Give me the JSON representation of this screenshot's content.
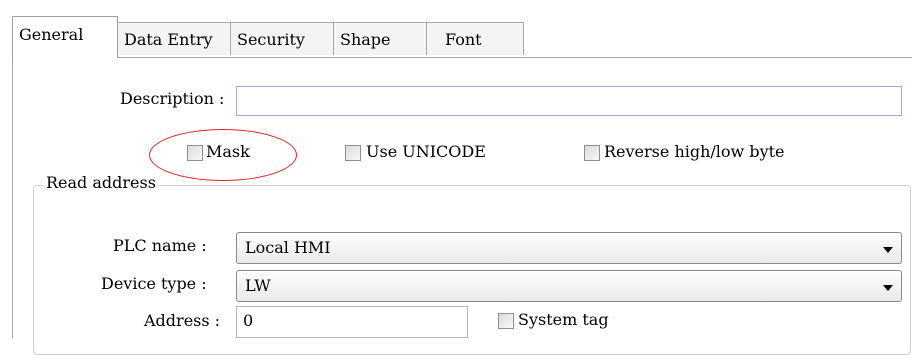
{
  "tabs": [
    {
      "label": "General",
      "active": true
    },
    {
      "label": "Data Entry",
      "active": false
    },
    {
      "label": "Security",
      "active": false
    },
    {
      "label": "Shape",
      "active": false
    },
    {
      "label": "Font",
      "active": false
    }
  ],
  "description": {
    "label": "Description :",
    "value": ""
  },
  "options": {
    "mask": {
      "label": "Mask",
      "checked": false
    },
    "use_unicode": {
      "label": "Use UNICODE",
      "checked": false
    },
    "reverse_byte": {
      "label": "Reverse high/low byte",
      "checked": false
    }
  },
  "read_address": {
    "title": "Read address",
    "plc_name": {
      "label": "PLC name :",
      "value": "Local HMI"
    },
    "device_type": {
      "label": "Device type :",
      "value": "LW"
    },
    "address": {
      "label": "Address :",
      "value": "0"
    },
    "system_tag": {
      "label": "System tag",
      "checked": false
    }
  },
  "annotation": {
    "color": "#e0262a"
  }
}
